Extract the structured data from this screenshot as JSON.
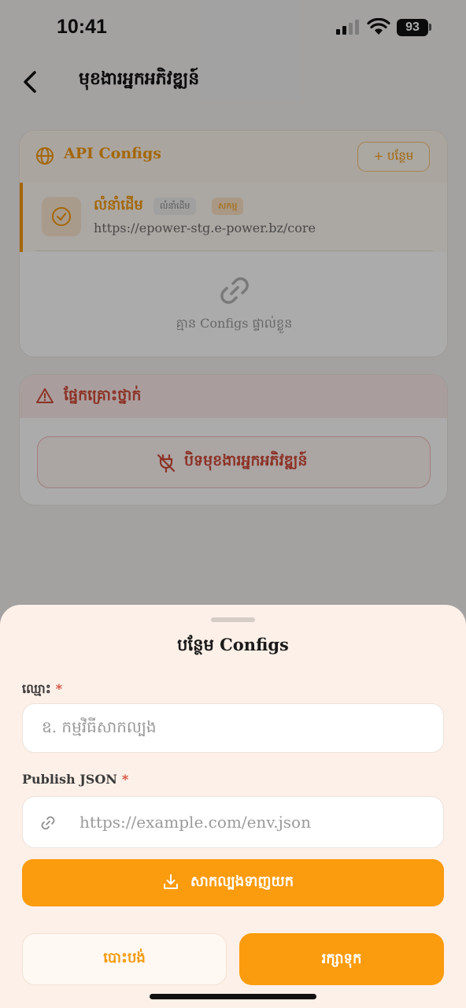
{
  "status_bar": {
    "time": "10:41",
    "battery": "93"
  },
  "nav": {
    "title": "មុខងារអ្នកអភិវឌ្ឍន៍"
  },
  "api_configs": {
    "title": "API Configs",
    "add_label": "+ បន្ថែម",
    "items": [
      {
        "name": "លំនាំដើម",
        "tag_default": "លំនាំដើម",
        "tag_active": "សកម្ម",
        "url": "https://epower-stg.e-power.bz/core"
      }
    ],
    "empty_text": "គ្មាន Configs ផ្ទាល់ខ្លួន"
  },
  "danger_zone": {
    "title": "ផ្នែកគ្រោះថ្នាក់",
    "disable_label": "បិទមុខងារអ្នកអភិវឌ្ឍន៍"
  },
  "sheet": {
    "title": "បន្ថែម Configs",
    "name_label": "ឈ្មោះ",
    "name_placeholder": "ឧ. កម្មវិធីសាកល្បង",
    "json_label": "Publish JSON",
    "json_placeholder": "https://example.com/env.json",
    "required_mark": "*",
    "test_label": "សាកល្បងទាញយក",
    "cancel_label": "បោះបង់",
    "save_label": "រក្សាទុក"
  },
  "colors": {
    "accent": "#fb9b0e",
    "danger": "#d24b3a",
    "sheet_bg": "#fdf0e8"
  }
}
